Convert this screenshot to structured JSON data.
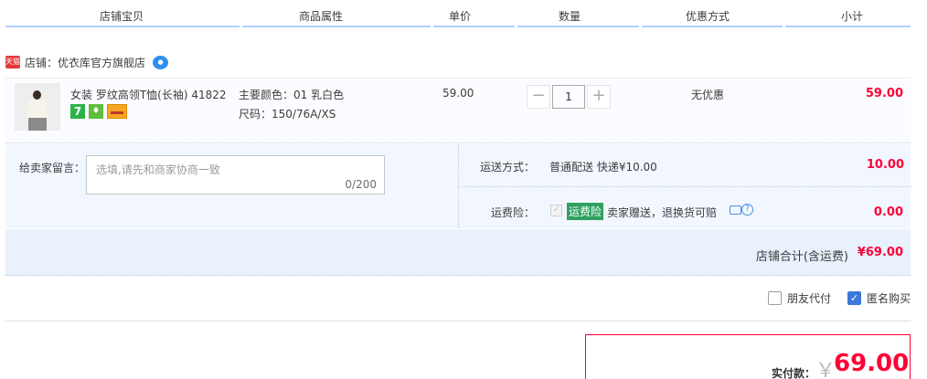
{
  "columns": [
    "店铺宝贝",
    "商品属性",
    "单价",
    "数量",
    "优惠方式",
    "小计"
  ],
  "shop": {
    "badge": "天猫",
    "label": "店铺：优衣库官方旗舰店",
    "chat_icon": "wangwang-icon"
  },
  "item": {
    "title": "女装 罗纹高领T恤(长袖) 41822",
    "color_attr": "主要颜色：01 乳白色",
    "size_attr": "尺码：150/76A/XS",
    "price": "59.00",
    "quantity": "1",
    "minus": "−",
    "plus": "+",
    "discount": "无优惠",
    "subtotal": "59.00",
    "badge_7": "7"
  },
  "message": {
    "label": "给卖家留言：",
    "placeholder": "选填,请先和商家协商一致",
    "count": "0/200"
  },
  "shipping": {
    "label": "运送方式：",
    "value": "普通配送 快递¥10.00",
    "fee": "10.00"
  },
  "insurance": {
    "label": "运费险：",
    "tag": "运费险",
    "text": "卖家赠送，退换货可赔",
    "fee": "0.00"
  },
  "shop_total": {
    "label": "店铺合计(含运费)",
    "value": "¥69.00"
  },
  "options": {
    "friend_pay": "朋友代付",
    "friend_pay_checked": false,
    "anonymous": "匿名购买",
    "anonymous_checked": true
  },
  "payment": {
    "label": "实付款：",
    "currency": "￥",
    "amount": "69.00"
  },
  "colors": {
    "accent_red": "#ff0036",
    "header_line": "#b2d1ff",
    "panel_bg": "#f2f7ff"
  }
}
